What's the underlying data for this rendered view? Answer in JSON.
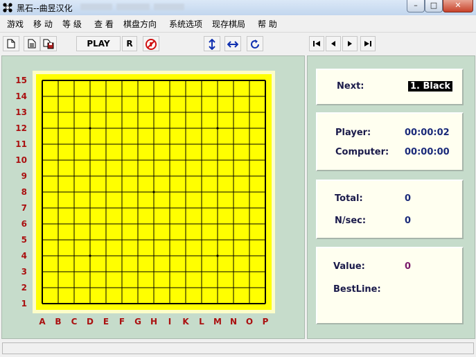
{
  "window": {
    "title": "黑石--曲昱汉化",
    "controls": {
      "minimize": "–",
      "maximize": "□",
      "close": "✕"
    }
  },
  "menu": [
    "游戏",
    "移 动",
    "等 级",
    "查 看",
    "棋盘方向",
    "系统选项",
    "现存棋局",
    "帮 助"
  ],
  "toolbar": {
    "new_icon": "new-document-icon",
    "open_icon": "open-document-icon",
    "save_icon": "save-icon",
    "play_label": "PLAY",
    "r_label": "R",
    "stop_icon": "no-entry-icon",
    "flip_v_icon": "vertical-arrows-icon",
    "flip_h_icon": "horizontal-arrows-icon",
    "rotate_icon": "rotate-icon",
    "nav_first_icon": "skip-first-icon",
    "nav_prev_icon": "previous-icon",
    "nav_next_icon": "next-icon",
    "nav_last_icon": "skip-last-icon"
  },
  "board": {
    "size": 15,
    "row_labels": [
      "15",
      "14",
      "13",
      "12",
      "11",
      "10",
      "9",
      "8",
      "7",
      "6",
      "5",
      "4",
      "3",
      "2",
      "1"
    ],
    "col_labels": [
      "A",
      "B",
      "C",
      "D",
      "E",
      "F",
      "G",
      "H",
      "I",
      "K",
      "L",
      "M",
      "N",
      "O",
      "P"
    ],
    "star_points": [
      [
        "D",
        "12"
      ],
      [
        "M",
        "12"
      ],
      [
        "H",
        "8"
      ],
      [
        "D",
        "4"
      ],
      [
        "M",
        "4"
      ]
    ],
    "colors": {
      "board": "#ffff00",
      "frame": "#fdfdc8",
      "grid": "#000000",
      "label": "#aa1010",
      "panel": "#c6dccb"
    }
  },
  "info": {
    "next": {
      "label": "Next:",
      "value": "1. Black"
    },
    "player": {
      "label": "Player:",
      "value": "00:00:02"
    },
    "computer": {
      "label": "Computer:",
      "value": "00:00:00"
    },
    "total": {
      "label": "Total:",
      "value": "0"
    },
    "nsec": {
      "label": "N/sec:",
      "value": "0"
    },
    "value": {
      "label": "Value:",
      "value": "0"
    },
    "bestline": {
      "label": "BestLine:",
      "value": ""
    }
  },
  "statusbar": {
    "text": ""
  }
}
